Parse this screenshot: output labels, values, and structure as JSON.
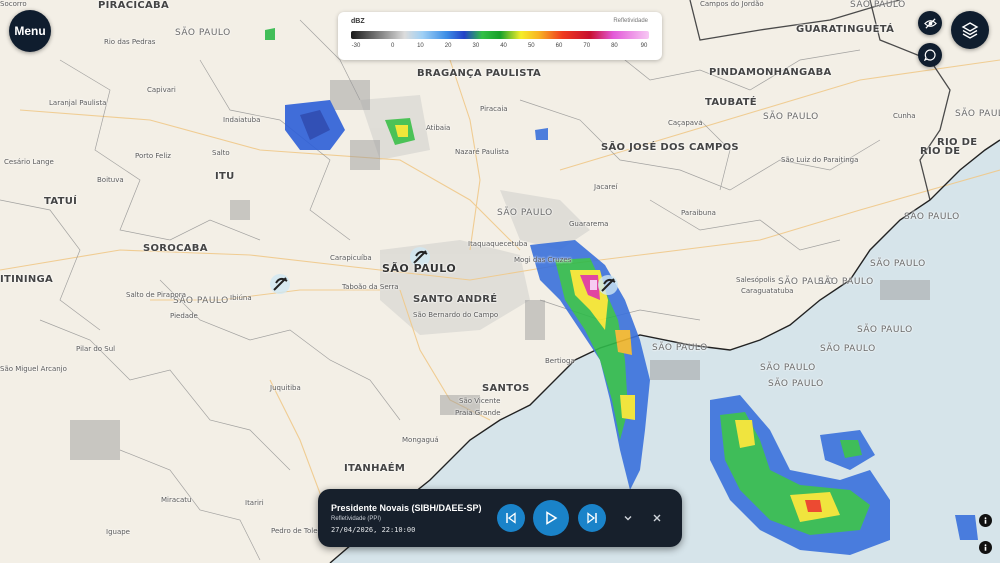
{
  "menu": {
    "label": "Menu"
  },
  "legend": {
    "unit": "dBZ",
    "quantity": "Refletividade",
    "ticks": [
      "-30",
      "0",
      "10",
      "20",
      "30",
      "40",
      "50",
      "60",
      "70",
      "80",
      "90"
    ]
  },
  "player": {
    "station": "Presidente Novais (SIBH/DAEE-SP)",
    "product": "Refletividade (PPI)",
    "datetime": "27/04/2026, 22:10:00",
    "accent": "#1a83c9"
  },
  "map": {
    "places": [
      {
        "name": "PIRACICABA",
        "cls": "city"
      },
      {
        "name": "SÃO PAULO",
        "cls": "state"
      },
      {
        "name": "Rio das Pedras",
        "cls": ""
      },
      {
        "name": "Capivari",
        "cls": ""
      },
      {
        "name": "Laranjal Paulista",
        "cls": ""
      },
      {
        "name": "Cesário Lange",
        "cls": ""
      },
      {
        "name": "Indaiatuba",
        "cls": ""
      },
      {
        "name": "Porto Feliz",
        "cls": ""
      },
      {
        "name": "Salto",
        "cls": ""
      },
      {
        "name": "ITU",
        "cls": "city"
      },
      {
        "name": "Boituva",
        "cls": ""
      },
      {
        "name": "TATUÍ",
        "cls": "city"
      },
      {
        "name": "SOROCABA",
        "cls": "city"
      },
      {
        "name": "ITININGA",
        "cls": "city"
      },
      {
        "name": "SÃO PAULO",
        "cls": "state"
      },
      {
        "name": "Salto de Pirapora",
        "cls": ""
      },
      {
        "name": "Piedade",
        "cls": ""
      },
      {
        "name": "Ibiúna",
        "cls": ""
      },
      {
        "name": "Pilar do Sul",
        "cls": ""
      },
      {
        "name": "São Miguel Arcanjo",
        "cls": ""
      },
      {
        "name": "Juquitiba",
        "cls": ""
      },
      {
        "name": "Miracatu",
        "cls": ""
      },
      {
        "name": "Iguape",
        "cls": ""
      },
      {
        "name": "Itariri",
        "cls": ""
      },
      {
        "name": "Pedro de Toledo",
        "cls": ""
      },
      {
        "name": "ITANHAÉM",
        "cls": "city"
      },
      {
        "name": "Mongaguá",
        "cls": ""
      },
      {
        "name": "Praia Grande",
        "cls": ""
      },
      {
        "name": "São Vicente",
        "cls": ""
      },
      {
        "name": "SANTOS",
        "cls": "city"
      },
      {
        "name": "Bertioga",
        "cls": ""
      },
      {
        "name": "SANTO ANDRÉ",
        "cls": "city"
      },
      {
        "name": "São Bernardo do Campo",
        "cls": ""
      },
      {
        "name": "Taboão da Serra",
        "cls": ""
      },
      {
        "name": "SÃO PAULO",
        "cls": "big"
      },
      {
        "name": "Carapicuíba",
        "cls": ""
      },
      {
        "name": "Itaquaquecetuba",
        "cls": ""
      },
      {
        "name": "Mogi das Cruzes",
        "cls": ""
      },
      {
        "name": "SÃO PAULO",
        "cls": "state"
      },
      {
        "name": "Guararema",
        "cls": ""
      },
      {
        "name": "Jacareí",
        "cls": ""
      },
      {
        "name": "SÃO JOSÉ DOS CAMPOS",
        "cls": "city"
      },
      {
        "name": "Nazaré Paulista",
        "cls": ""
      },
      {
        "name": "Atibaia",
        "cls": ""
      },
      {
        "name": "BRAGANÇA PAULISTA",
        "cls": "city"
      },
      {
        "name": "Piracaia",
        "cls": ""
      },
      {
        "name": "Caçapava",
        "cls": ""
      },
      {
        "name": "TAUBATÉ",
        "cls": "city"
      },
      {
        "name": "PINDAMONHANGABA",
        "cls": "city"
      },
      {
        "name": "Campos do Jordão",
        "cls": ""
      },
      {
        "name": "GUARATINGUETÁ",
        "cls": "city"
      },
      {
        "name": "SÃO PAULO",
        "cls": "state"
      },
      {
        "name": "Cunha",
        "cls": ""
      },
      {
        "name": "São Luiz do Paraitinga",
        "cls": ""
      },
      {
        "name": "Paraibuna",
        "cls": ""
      },
      {
        "name": "Salesópolis",
        "cls": ""
      },
      {
        "name": "Caraguatatuba",
        "cls": ""
      },
      {
        "name": "SÃO PAULO",
        "cls": "state"
      },
      {
        "name": "SÃO PAULO",
        "cls": "state"
      },
      {
        "name": "SÃO PAULO",
        "cls": "state"
      },
      {
        "name": "SÃO PAULO",
        "cls": "state"
      },
      {
        "name": "SÃO PAULO",
        "cls": "state"
      },
      {
        "name": "SÃO PAULO",
        "cls": "state"
      },
      {
        "name": "SÃO PAULO",
        "cls": "state"
      },
      {
        "name": "SÃO PAULO",
        "cls": "state"
      },
      {
        "name": "SÃO PAULO",
        "cls": "state"
      },
      {
        "name": "SÃO PAULO",
        "cls": "state"
      },
      {
        "name": "RIO DE",
        "cls": "city"
      },
      {
        "name": "RIO DE",
        "cls": "city"
      },
      {
        "name": "SÃO PAULO",
        "cls": "state"
      },
      {
        "name": "Socorro",
        "cls": ""
      }
    ]
  },
  "colors": {
    "ocean": "#d6e4ea",
    "land": "#f3efe6",
    "border": "#5b5b5b",
    "dark_button": "#0f1d2e"
  }
}
